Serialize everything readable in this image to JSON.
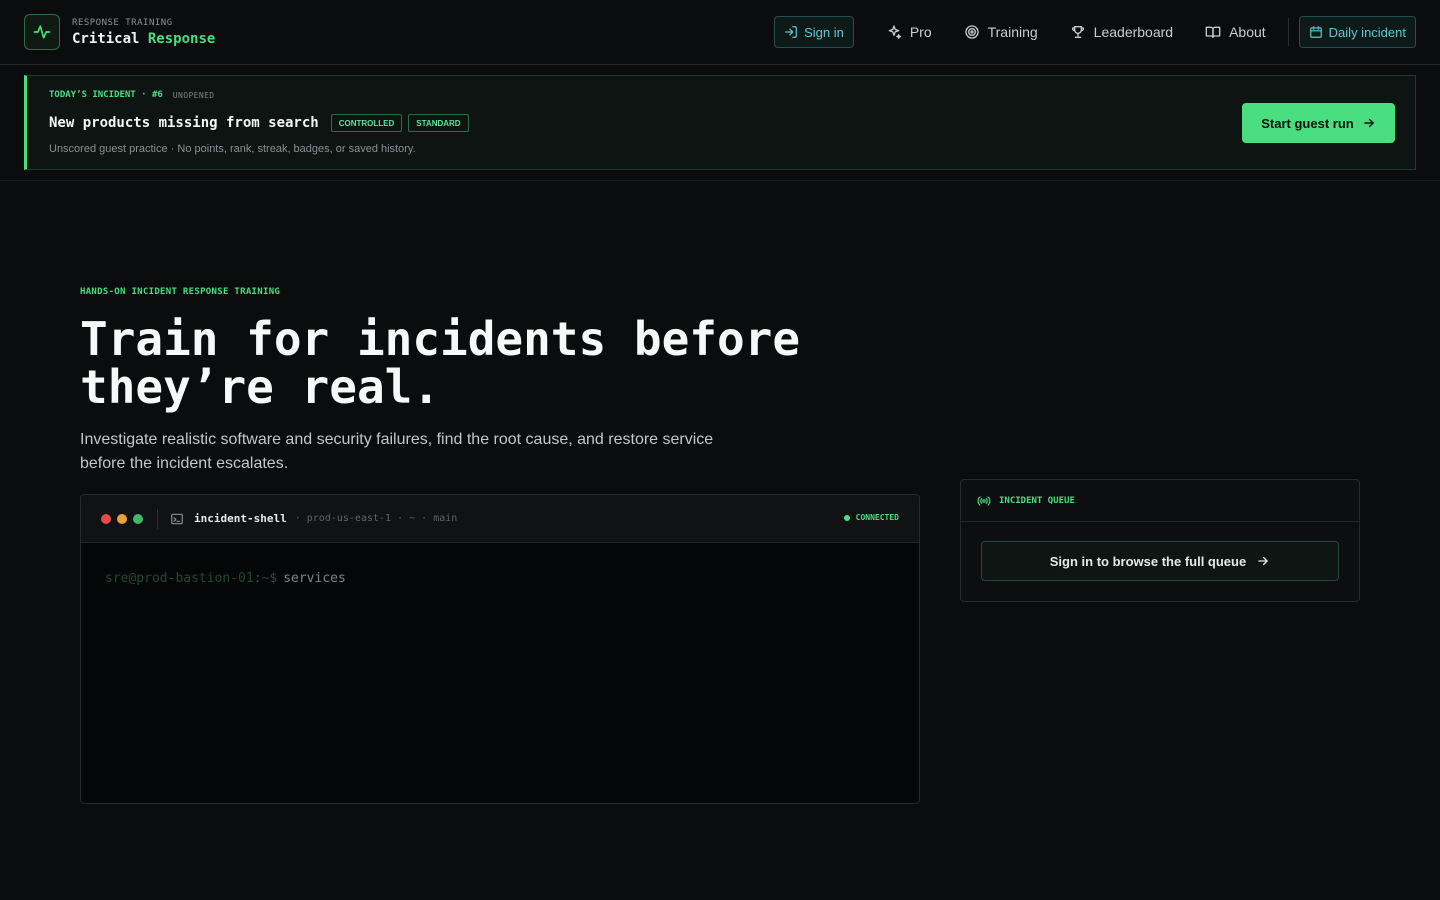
{
  "brand": {
    "eyebrow": "RESPONSE TRAINING",
    "name_part1": "Critical",
    "name_part2": "Response"
  },
  "nav": {
    "sign_in": "Sign in",
    "pro": "Pro",
    "training": "Training",
    "leaderboard": "Leaderboard",
    "about": "About",
    "daily_incident": "Daily incident"
  },
  "incident": {
    "eyebrow": "TODAY’S INCIDENT · #6",
    "status": "UNOPENED",
    "title": "New products missing from search",
    "tags": [
      "CONTROLLED",
      "STANDARD"
    ],
    "description": "Unscored guest practice · No points, rank, streak, badges, or saved history.",
    "cta": "Start guest run"
  },
  "hero": {
    "eyebrow": "HANDS-ON INCIDENT RESPONSE TRAINING",
    "title_line1": "Train for incidents before",
    "title_line2": "they’re real.",
    "subtitle": "Investigate realistic software and security failures, find the root cause, and restore service before the incident escalates."
  },
  "terminal": {
    "name": "incident-shell",
    "meta": "· prod-us-east-1 · ~ · main",
    "status": "CONNECTED",
    "prompt_user": "sre@prod-bastion-01",
    "prompt_rest": ":~$",
    "command": "services"
  },
  "queue": {
    "label": "INCIDENT QUEUE",
    "cta": "Sign in to browse the full queue"
  },
  "colors": {
    "accent": "#4ade80",
    "background": "#0b0c0d",
    "link": "#5cc9d1"
  },
  "icons": [
    "pulse-icon",
    "sign-in-icon",
    "sparkles-icon",
    "target-icon",
    "trophy-icon",
    "book-icon",
    "calendar-icon",
    "arrow-right-icon",
    "terminal-icon",
    "broadcast-icon"
  ]
}
